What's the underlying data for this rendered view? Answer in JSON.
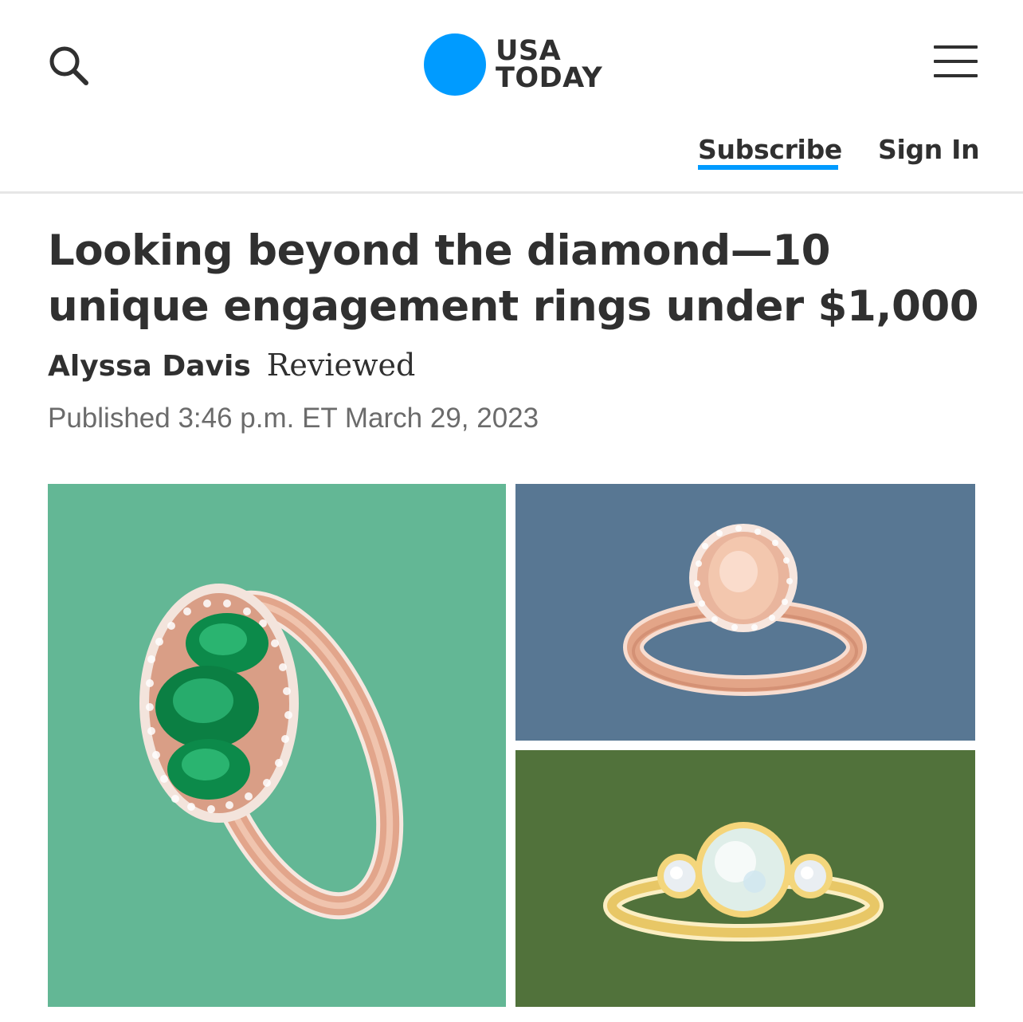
{
  "header": {
    "logo_line1": "USA",
    "logo_line2": "TODAY",
    "subscribe_label": "Subscribe",
    "signin_label": "Sign In",
    "icons": {
      "search": "search-icon",
      "menu": "hamburger-menu-icon"
    }
  },
  "article": {
    "headline": "Looking beyond the diamond—10 unique engagement rings under $1,000",
    "author": "Alyssa Davis",
    "brand": "Reviewed",
    "published": "Published 3:46 p.m. ET March 29, 2023"
  },
  "collage": {
    "images": [
      {
        "name": "emerald-rose-gold-ring-image",
        "background": "#63b795"
      },
      {
        "name": "morganite-halo-ring-image",
        "background": "#587793"
      },
      {
        "name": "opal-gold-ring-image",
        "background": "#51723b"
      }
    ]
  },
  "colors": {
    "accent": "#009bff",
    "text": "#303030",
    "meta_text": "#6b6b6b",
    "divider": "#e6e6e6"
  }
}
